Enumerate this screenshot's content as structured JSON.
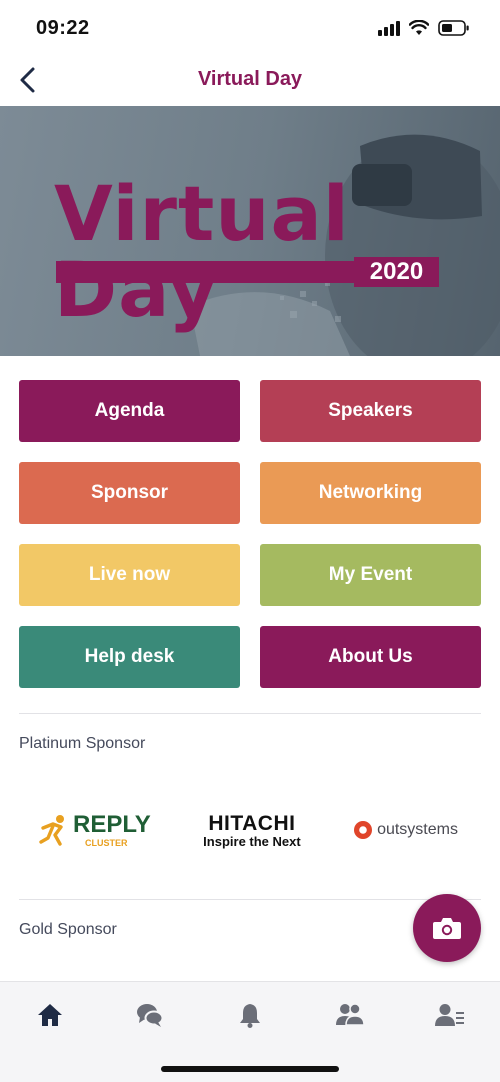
{
  "status_bar": {
    "time": "09:22"
  },
  "header": {
    "title": "Virtual Day"
  },
  "banner": {
    "title": "Virtual Day",
    "year": "2020"
  },
  "menu": [
    {
      "label": "Agenda",
      "color": "#8a1a5a"
    },
    {
      "label": "Speakers",
      "color": "#b43f55"
    },
    {
      "label": "Sponsor",
      "color": "#db6a50"
    },
    {
      "label": "Networking",
      "color": "#ea9a55"
    },
    {
      "label": "Live now",
      "color": "#f2c866"
    },
    {
      "label": "My Event",
      "color": "#a5ba60"
    },
    {
      "label": "Help desk",
      "color": "#3a8a79"
    },
    {
      "label": "About Us",
      "color": "#8a1a5a"
    }
  ],
  "sections": {
    "platinum": "Platinum Sponsor",
    "gold": "Gold Sponsor"
  },
  "sponsors": {
    "reply": {
      "name": "REPLY",
      "sub": "CLUSTER"
    },
    "hitachi": {
      "name": "HITACHI",
      "tagline": "Inspire the Next"
    },
    "outsystems": {
      "name": "outsystems"
    }
  },
  "tabs": [
    "home-icon",
    "chat-icon",
    "bell-icon",
    "people-icon",
    "profile-icon"
  ],
  "colors": {
    "brand": "#8a1a5a",
    "tab_active": "#1f2b45",
    "tab_inactive": "#6b6e78"
  }
}
